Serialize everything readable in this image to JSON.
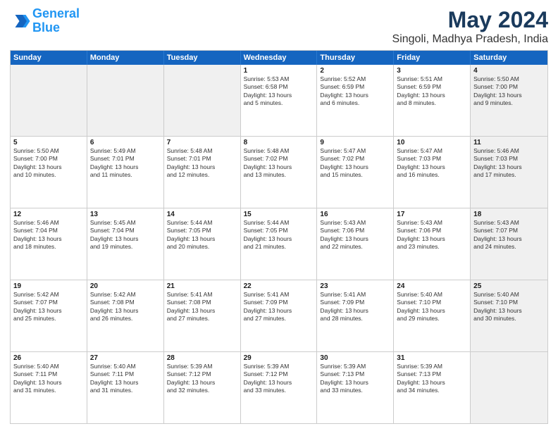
{
  "logo": {
    "line1": "General",
    "line2": "Blue"
  },
  "title": "May 2024",
  "subtitle": "Singoli, Madhya Pradesh, India",
  "header": {
    "days": [
      "Sunday",
      "Monday",
      "Tuesday",
      "Wednesday",
      "Thursday",
      "Friday",
      "Saturday"
    ]
  },
  "rows": [
    [
      {
        "day": "",
        "info": "",
        "shaded": true
      },
      {
        "day": "",
        "info": "",
        "shaded": true
      },
      {
        "day": "",
        "info": "",
        "shaded": true
      },
      {
        "day": "1",
        "info": "Sunrise: 5:53 AM\nSunset: 6:58 PM\nDaylight: 13 hours\nand 5 minutes."
      },
      {
        "day": "2",
        "info": "Sunrise: 5:52 AM\nSunset: 6:59 PM\nDaylight: 13 hours\nand 6 minutes."
      },
      {
        "day": "3",
        "info": "Sunrise: 5:51 AM\nSunset: 6:59 PM\nDaylight: 13 hours\nand 8 minutes."
      },
      {
        "day": "4",
        "info": "Sunrise: 5:50 AM\nSunset: 7:00 PM\nDaylight: 13 hours\nand 9 minutes.",
        "shaded": true
      }
    ],
    [
      {
        "day": "5",
        "info": "Sunrise: 5:50 AM\nSunset: 7:00 PM\nDaylight: 13 hours\nand 10 minutes."
      },
      {
        "day": "6",
        "info": "Sunrise: 5:49 AM\nSunset: 7:01 PM\nDaylight: 13 hours\nand 11 minutes."
      },
      {
        "day": "7",
        "info": "Sunrise: 5:48 AM\nSunset: 7:01 PM\nDaylight: 13 hours\nand 12 minutes."
      },
      {
        "day": "8",
        "info": "Sunrise: 5:48 AM\nSunset: 7:02 PM\nDaylight: 13 hours\nand 13 minutes."
      },
      {
        "day": "9",
        "info": "Sunrise: 5:47 AM\nSunset: 7:02 PM\nDaylight: 13 hours\nand 15 minutes."
      },
      {
        "day": "10",
        "info": "Sunrise: 5:47 AM\nSunset: 7:03 PM\nDaylight: 13 hours\nand 16 minutes."
      },
      {
        "day": "11",
        "info": "Sunrise: 5:46 AM\nSunset: 7:03 PM\nDaylight: 13 hours\nand 17 minutes.",
        "shaded": true
      }
    ],
    [
      {
        "day": "12",
        "info": "Sunrise: 5:46 AM\nSunset: 7:04 PM\nDaylight: 13 hours\nand 18 minutes."
      },
      {
        "day": "13",
        "info": "Sunrise: 5:45 AM\nSunset: 7:04 PM\nDaylight: 13 hours\nand 19 minutes."
      },
      {
        "day": "14",
        "info": "Sunrise: 5:44 AM\nSunset: 7:05 PM\nDaylight: 13 hours\nand 20 minutes."
      },
      {
        "day": "15",
        "info": "Sunrise: 5:44 AM\nSunset: 7:05 PM\nDaylight: 13 hours\nand 21 minutes."
      },
      {
        "day": "16",
        "info": "Sunrise: 5:43 AM\nSunset: 7:06 PM\nDaylight: 13 hours\nand 22 minutes."
      },
      {
        "day": "17",
        "info": "Sunrise: 5:43 AM\nSunset: 7:06 PM\nDaylight: 13 hours\nand 23 minutes."
      },
      {
        "day": "18",
        "info": "Sunrise: 5:43 AM\nSunset: 7:07 PM\nDaylight: 13 hours\nand 24 minutes.",
        "shaded": true
      }
    ],
    [
      {
        "day": "19",
        "info": "Sunrise: 5:42 AM\nSunset: 7:07 PM\nDaylight: 13 hours\nand 25 minutes."
      },
      {
        "day": "20",
        "info": "Sunrise: 5:42 AM\nSunset: 7:08 PM\nDaylight: 13 hours\nand 26 minutes."
      },
      {
        "day": "21",
        "info": "Sunrise: 5:41 AM\nSunset: 7:08 PM\nDaylight: 13 hours\nand 27 minutes."
      },
      {
        "day": "22",
        "info": "Sunrise: 5:41 AM\nSunset: 7:09 PM\nDaylight: 13 hours\nand 27 minutes."
      },
      {
        "day": "23",
        "info": "Sunrise: 5:41 AM\nSunset: 7:09 PM\nDaylight: 13 hours\nand 28 minutes."
      },
      {
        "day": "24",
        "info": "Sunrise: 5:40 AM\nSunset: 7:10 PM\nDaylight: 13 hours\nand 29 minutes."
      },
      {
        "day": "25",
        "info": "Sunrise: 5:40 AM\nSunset: 7:10 PM\nDaylight: 13 hours\nand 30 minutes.",
        "shaded": true
      }
    ],
    [
      {
        "day": "26",
        "info": "Sunrise: 5:40 AM\nSunset: 7:11 PM\nDaylight: 13 hours\nand 31 minutes."
      },
      {
        "day": "27",
        "info": "Sunrise: 5:40 AM\nSunset: 7:11 PM\nDaylight: 13 hours\nand 31 minutes."
      },
      {
        "day": "28",
        "info": "Sunrise: 5:39 AM\nSunset: 7:12 PM\nDaylight: 13 hours\nand 32 minutes."
      },
      {
        "day": "29",
        "info": "Sunrise: 5:39 AM\nSunset: 7:12 PM\nDaylight: 13 hours\nand 33 minutes."
      },
      {
        "day": "30",
        "info": "Sunrise: 5:39 AM\nSunset: 7:13 PM\nDaylight: 13 hours\nand 33 minutes."
      },
      {
        "day": "31",
        "info": "Sunrise: 5:39 AM\nSunset: 7:13 PM\nDaylight: 13 hours\nand 34 minutes."
      },
      {
        "day": "",
        "info": "",
        "shaded": true
      }
    ]
  ]
}
